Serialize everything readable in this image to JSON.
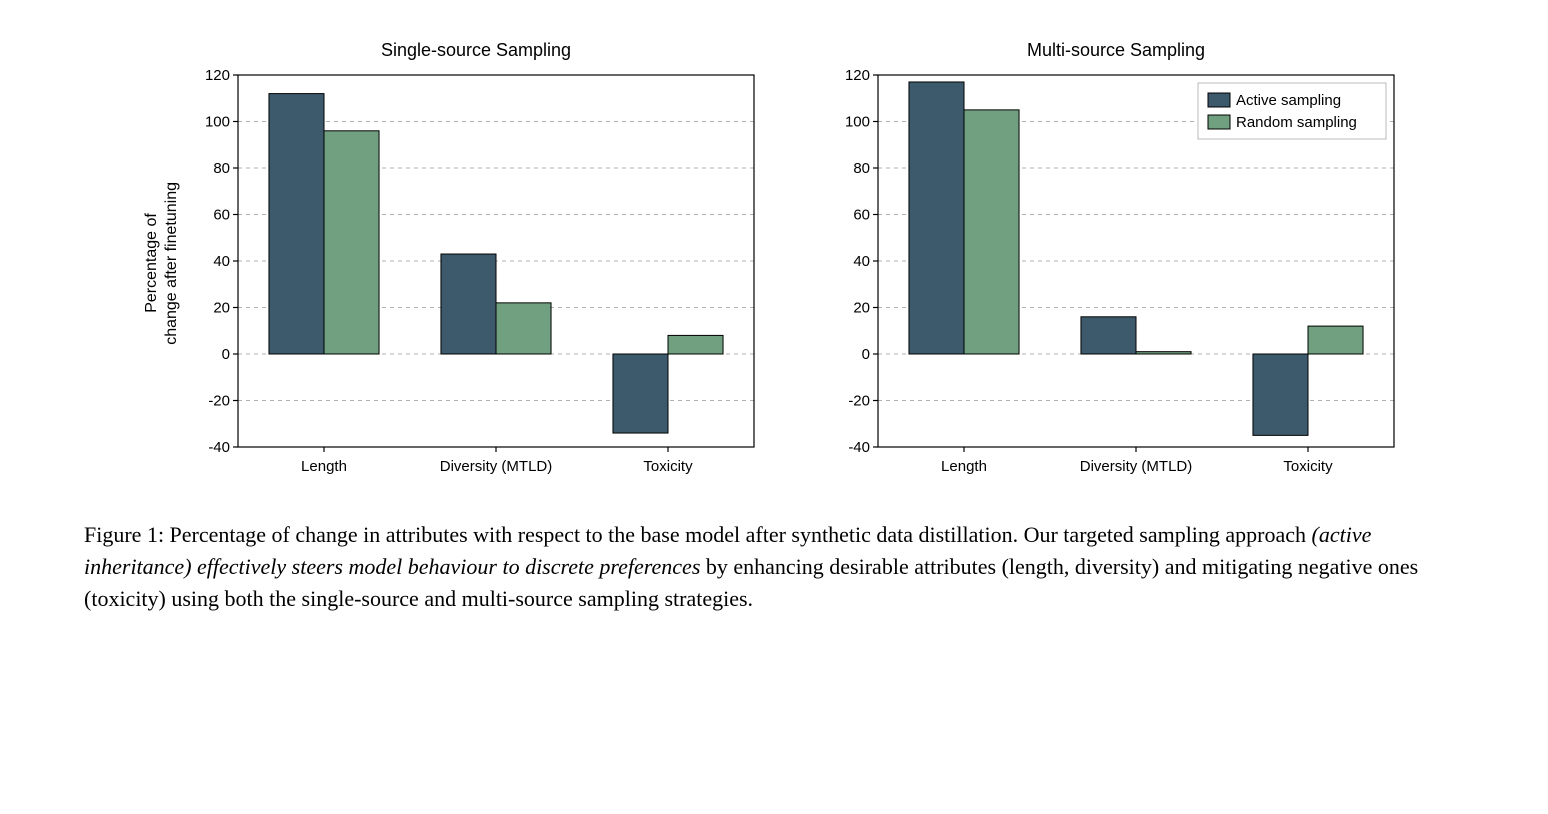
{
  "chart_data": [
    {
      "type": "bar",
      "title": "Single-source Sampling",
      "ylabel_line1": "Percentage of",
      "ylabel_line2": "change after finetuning",
      "ylim": [
        -40,
        120
      ],
      "yticks": [
        -40,
        -20,
        0,
        20,
        40,
        60,
        80,
        100,
        120
      ],
      "categories": [
        "Length",
        "Diversity (MTLD)",
        "Toxicity"
      ],
      "series": [
        {
          "name": "Active sampling",
          "values": [
            112,
            43,
            -34
          ]
        },
        {
          "name": "Random sampling",
          "values": [
            96,
            22,
            8
          ]
        }
      ],
      "legend": false
    },
    {
      "type": "bar",
      "title": "Multi-source Sampling",
      "ylim": [
        -40,
        120
      ],
      "yticks": [
        -40,
        -20,
        0,
        20,
        40,
        60,
        80,
        100,
        120
      ],
      "categories": [
        "Length",
        "Diversity (MTLD)",
        "Toxicity"
      ],
      "series": [
        {
          "name": "Active sampling",
          "values": [
            117,
            16,
            -35
          ]
        },
        {
          "name": "Random sampling",
          "values": [
            105,
            1,
            12
          ]
        }
      ],
      "legend": true
    }
  ],
  "colors": {
    "active": "#3c5a6c",
    "random": "#70a080"
  },
  "caption": {
    "prefix": "Figure 1:  Percentage of change in attributes with respect to the base model after synthetic data distillation. Our targeted sampling approach ",
    "italic": "(active inheritance) effectively steers model behaviour to discrete preferences",
    "suffix": " by enhancing desirable attributes (length, diversity) and mitigating negative ones (toxicity) using both the single-source and multi-source sampling strategies."
  }
}
